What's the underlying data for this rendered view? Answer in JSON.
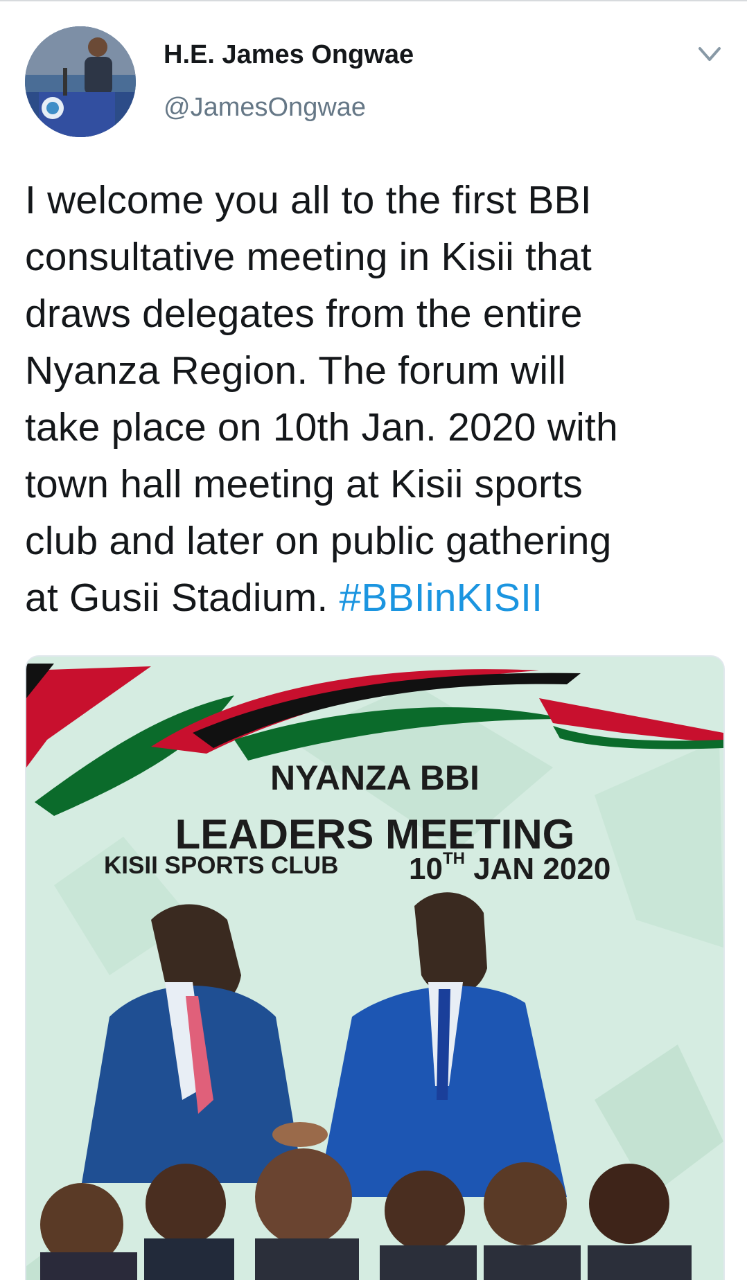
{
  "author": {
    "name": "H.E. James Ongwae",
    "handle": "@JamesOngwae"
  },
  "tweet": {
    "lines": [
      "I welcome you all to the first BBI",
      "consultative meeting in Kisii that",
      "draws delegates from the entire",
      "Nyanza Region. The forum will",
      "take place on 10th Jan. 2020 with",
      "town hall meeting at Kisii sports",
      "club and later on public gathering",
      "at Gusii Stadium."
    ],
    "hashtag": "#BBIinKISII"
  },
  "media": {
    "title_line1": "NYANZA BBI",
    "title_line2": "LEADERS MEETING",
    "venue": "KISII SPORTS CLUB",
    "date_day": "10",
    "date_suffix": "TH",
    "date_rest": "JAN 2020"
  },
  "icons": {
    "caret": "chevron-down-icon"
  },
  "colors": {
    "text": "#14171a",
    "secondary": "#657786",
    "link": "#1b95e0",
    "poster_bg": "#d5ece1",
    "flag_red": "#c8102e",
    "flag_green": "#0b6b2b",
    "flag_black": "#111111"
  }
}
